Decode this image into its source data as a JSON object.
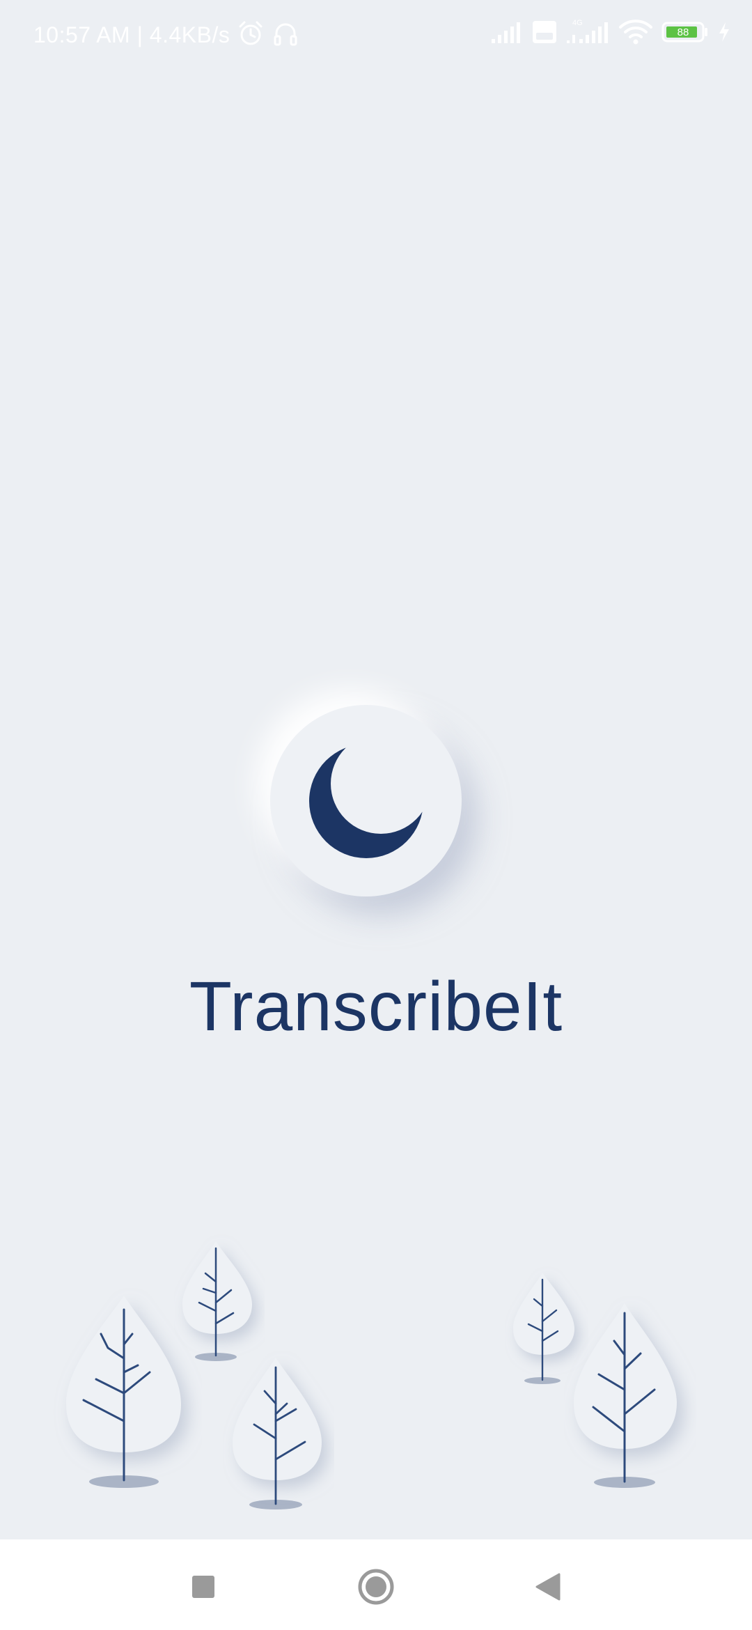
{
  "status_bar": {
    "time_speed": "10:57 AM | 4.4KB/s",
    "battery_level": "88",
    "icons": [
      "alarm-icon",
      "headphones-icon",
      "signal-icon",
      "volte-icon",
      "signal-4g-icon",
      "wifi-icon",
      "battery-icon",
      "charging-icon"
    ]
  },
  "app": {
    "title": "TranscribeIt",
    "logo_icon": "crescent-moon-icon",
    "brand_color": "#1c3564",
    "background_color": "#eceff3"
  },
  "nav_bar": {
    "buttons": [
      "recents-button",
      "home-button",
      "back-button"
    ]
  }
}
